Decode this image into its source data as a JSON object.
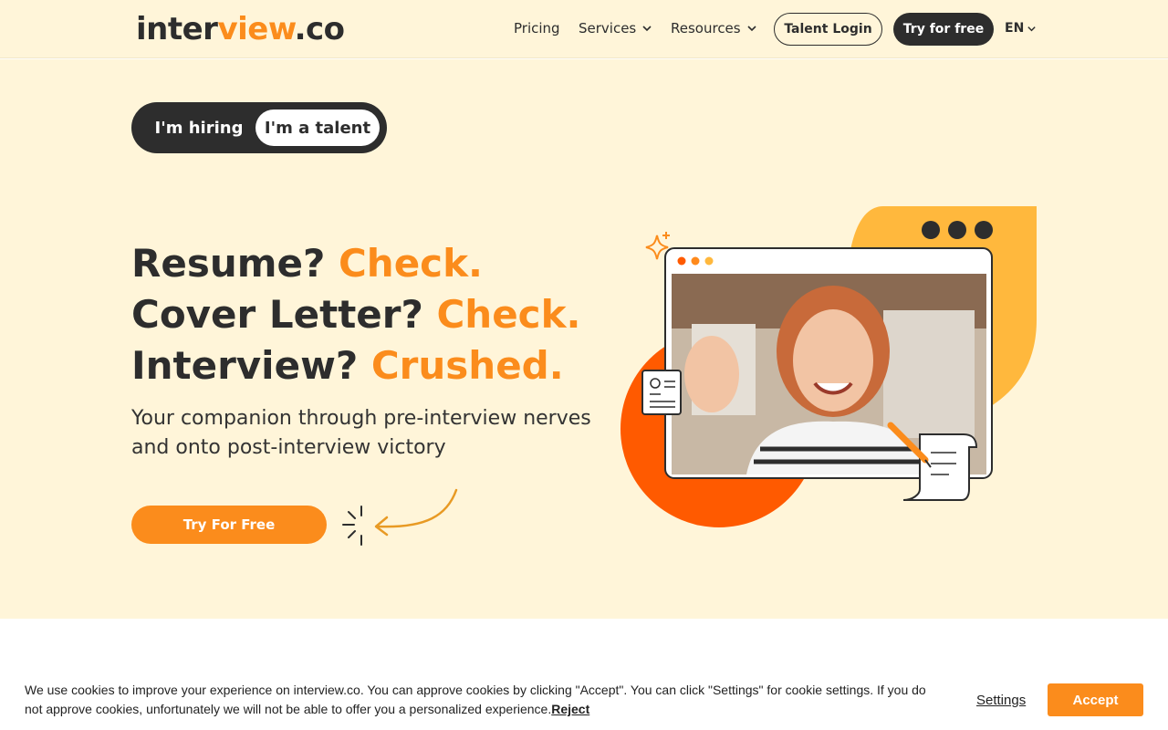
{
  "header": {
    "logo": {
      "part1": "inter",
      "part2": "view",
      "part3": ".co"
    },
    "nav": {
      "pricing": "Pricing",
      "services": "Services",
      "resources": "Resources"
    },
    "talent_login": "Talent Login",
    "try_free": "Try for free",
    "lang": "EN"
  },
  "hero": {
    "toggle": {
      "hiring": "I'm hiring",
      "talent": "I'm a talent",
      "selected": "I'm a talent"
    },
    "headline": {
      "line1_a": "Resume? ",
      "line1_b": "Check.",
      "line2_a": "Cover Letter? ",
      "line2_b": "Check.",
      "line3_a": "Interview? ",
      "line3_b": "Crushed."
    },
    "subtitle": "Your companion through pre-interview nerves and onto post-interview victory",
    "cta": "Try For Free"
  },
  "cookie": {
    "text": "We use cookies to improve your experience on interview.co. You can approve cookies by clicking \"Accept\". You can click \"Settings\" for cookie settings. If you do not approve cookies, unfortunately we will not be able to offer you a personalized experience.",
    "reject": "Reject",
    "settings": "Settings",
    "accept": "Accept"
  },
  "colors": {
    "accent": "#fb8c1c",
    "dark": "#2d2d2d",
    "hero_bg": "#fff5d9",
    "shape_red": "#ff5a00",
    "shape_yellow": "#ffb83d"
  },
  "icons": [
    "chevron-down-icon",
    "sparkle-icon",
    "arrow-doodle-icon",
    "resume-document-icon",
    "scroll-pen-icon",
    "video-window-illustration"
  ]
}
